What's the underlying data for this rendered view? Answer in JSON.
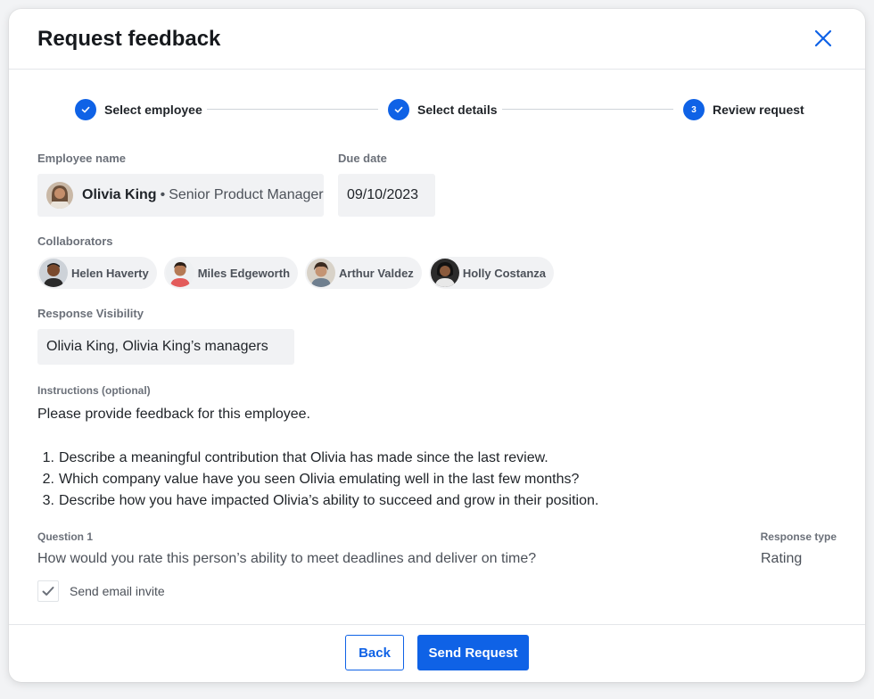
{
  "dialog": {
    "title": "Request feedback"
  },
  "stepper": {
    "steps": [
      {
        "label": "Select employee",
        "state": "complete",
        "marker": "check-icon"
      },
      {
        "label": "Select details",
        "state": "complete",
        "marker": "check-icon"
      },
      {
        "label": "Review request",
        "state": "current",
        "marker": "3"
      }
    ]
  },
  "employee": {
    "label": "Employee name",
    "name": "Olivia King",
    "separator": "•",
    "role": "Senior Product Manager"
  },
  "due_date": {
    "label": "Due date",
    "value": "09/10/2023"
  },
  "collaborators": {
    "label": "Collaborators",
    "people": [
      {
        "name": "Helen Haverty"
      },
      {
        "name": "Miles Edgeworth"
      },
      {
        "name": "Arthur Valdez"
      },
      {
        "name": "Holly Costanza"
      }
    ]
  },
  "visibility": {
    "label": "Response Visibility",
    "value": "Olivia King, Olivia King’s managers"
  },
  "instructions": {
    "label": "Instructions (optional)",
    "intro": "Please provide feedback for this employee.",
    "items": [
      {
        "num": "1.",
        "text": "Describe a meaningful contribution that Olivia has made since the last review."
      },
      {
        "num": "2.",
        "text": "Which company value have you seen Olivia emulating well in the last few months?"
      },
      {
        "num": "3.",
        "text": "Describe how you have impacted Olivia’s ability to succeed and grow in their position."
      }
    ]
  },
  "question": {
    "label": "Question 1",
    "text": "How would you rate this person’s ability to meet deadlines and deliver on time?",
    "response_type_label": "Response type",
    "response_type": "Rating"
  },
  "email_invite": {
    "label": "Send email invite",
    "checked": true
  },
  "footer": {
    "back_label": "Back",
    "send_label": "Send Request"
  },
  "colors": {
    "accent": "#0f62e6",
    "field_bg": "#f1f2f4"
  }
}
